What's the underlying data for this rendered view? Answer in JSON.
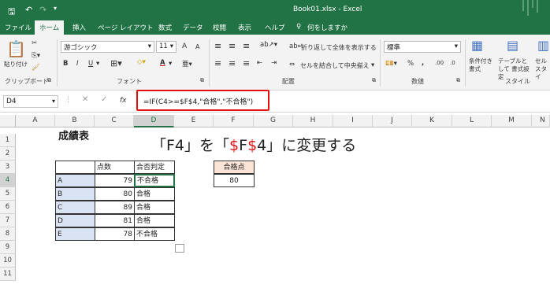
{
  "window": {
    "doc_title": "Book01.xlsx - Excel"
  },
  "menu": [
    "ファイル",
    "ホーム",
    "挿入",
    "ページ レイアウト",
    "数式",
    "データ",
    "校閲",
    "表示",
    "ヘルプ",
    "何をしますか"
  ],
  "ribbon": {
    "clipboard": {
      "paste": "貼り付け",
      "group": "クリップボード"
    },
    "font": {
      "name": "游ゴシック",
      "size": "11",
      "group": "フォント",
      "bold": "B",
      "italic": "I",
      "underline": "U",
      "grow": "A",
      "shrink": "A"
    },
    "align": {
      "wrap": "折り返して全体を表示する",
      "merge": "セルを結合して中央揃え",
      "group": "配置"
    },
    "number": {
      "format": "標準",
      "percent": "%",
      "comma": ",",
      "inc": ".00",
      "dec": ".0",
      "group": "数値"
    },
    "styles": {
      "conditional": "条件付き 書式",
      "table": "テーブルとして 書式設定",
      "cell": "セル スタイ",
      "group": "スタイル"
    }
  },
  "formula_bar": {
    "namebox": "D4",
    "fx": "fx",
    "formula": "=IF(C4>=$F$4,\"合格\",\"不合格\")"
  },
  "columns": [
    "A",
    "B",
    "C",
    "D",
    "E",
    "F",
    "G",
    "H",
    "I",
    "J",
    "K",
    "L",
    "M",
    "N"
  ],
  "rows": [
    "1",
    "2",
    "3",
    "4",
    "5",
    "6",
    "7",
    "8",
    "9",
    "10",
    "11"
  ],
  "sheet": {
    "title": "成績表",
    "headers": {
      "score": "点数",
      "result": "合否判定",
      "pass_header": "合格点",
      "pass_value": "80"
    },
    "data": [
      {
        "name": "A",
        "score": "79",
        "result": "不合格"
      },
      {
        "name": "B",
        "score": "80",
        "result": "合格"
      },
      {
        "name": "C",
        "score": "89",
        "result": "合格"
      },
      {
        "name": "D",
        "score": "81",
        "result": "合格"
      },
      {
        "name": "E",
        "score": "78",
        "result": "不合格"
      }
    ]
  },
  "annotation": {
    "part1": "「F4」を「",
    "part2": "$",
    "part3": "F",
    "part4": "$",
    "part5": "4」に変更する"
  },
  "colors": {
    "excel_green": "#217346",
    "highlight_red": "#e01010",
    "name_fill": "#dae3f3",
    "pass_fill": "#fce4d6"
  }
}
